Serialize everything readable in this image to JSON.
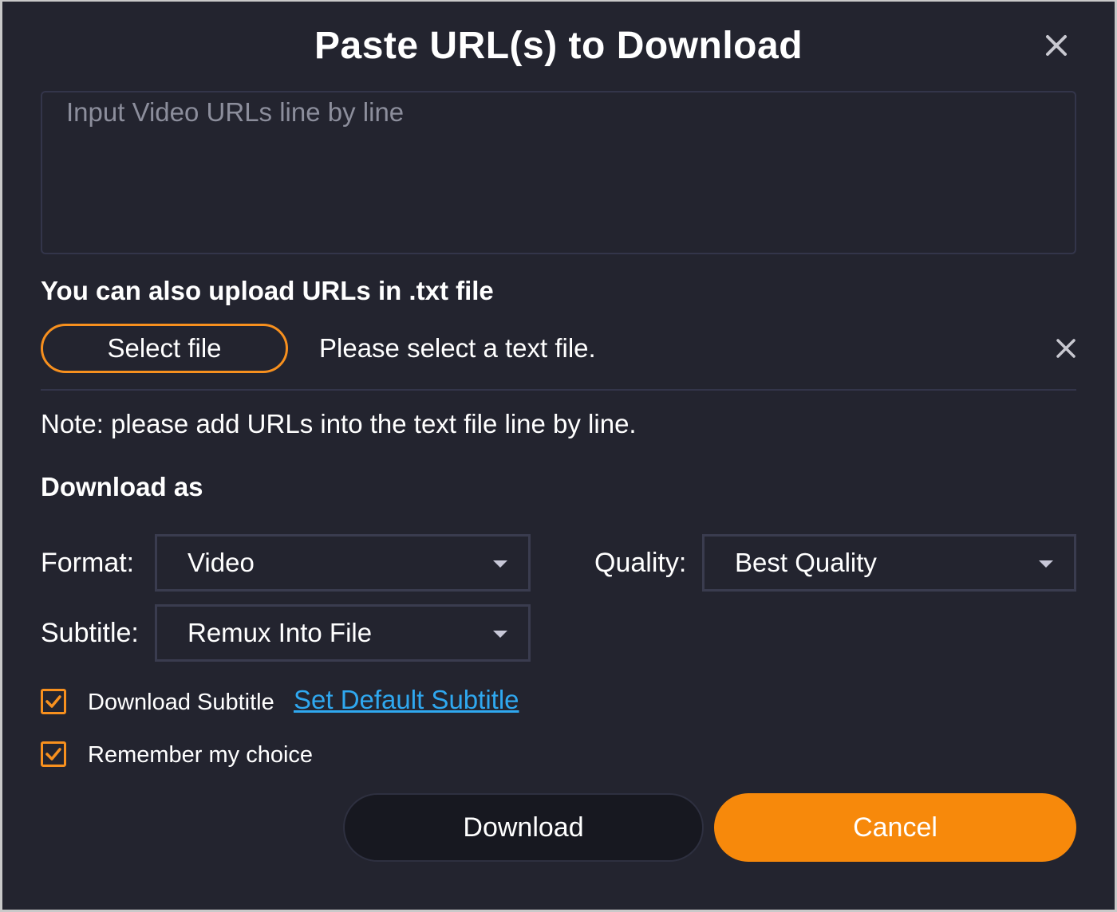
{
  "dialog": {
    "title": "Paste URL(s) to Download"
  },
  "url_input": {
    "placeholder": "Input Video URLs line by line",
    "value": ""
  },
  "upload": {
    "heading": "You can also upload URLs in .txt file",
    "select_button_label": "Select file",
    "status_text": "Please select a text file.",
    "note": "Note: please add URLs into the text file line by line."
  },
  "download_as": {
    "heading": "Download as",
    "format_label": "Format:",
    "format_value": "Video",
    "quality_label": "Quality:",
    "quality_value": "Best Quality",
    "subtitle_label": "Subtitle:",
    "subtitle_value": "Remux Into File"
  },
  "options": {
    "download_subtitle_label": "Download Subtitle",
    "download_subtitle_checked": true,
    "set_default_subtitle_link": "Set Default Subtitle",
    "remember_choice_label": "Remember my choice",
    "remember_choice_checked": true
  },
  "buttons": {
    "download_label": "Download",
    "cancel_label": "Cancel"
  },
  "colors": {
    "accent": "#f7901e",
    "background": "#23242f",
    "link": "#2fa8f0"
  },
  "icons": {
    "close": "close-icon",
    "clear": "close-icon",
    "dropdown": "caret-down-icon",
    "check": "checkmark-icon"
  }
}
